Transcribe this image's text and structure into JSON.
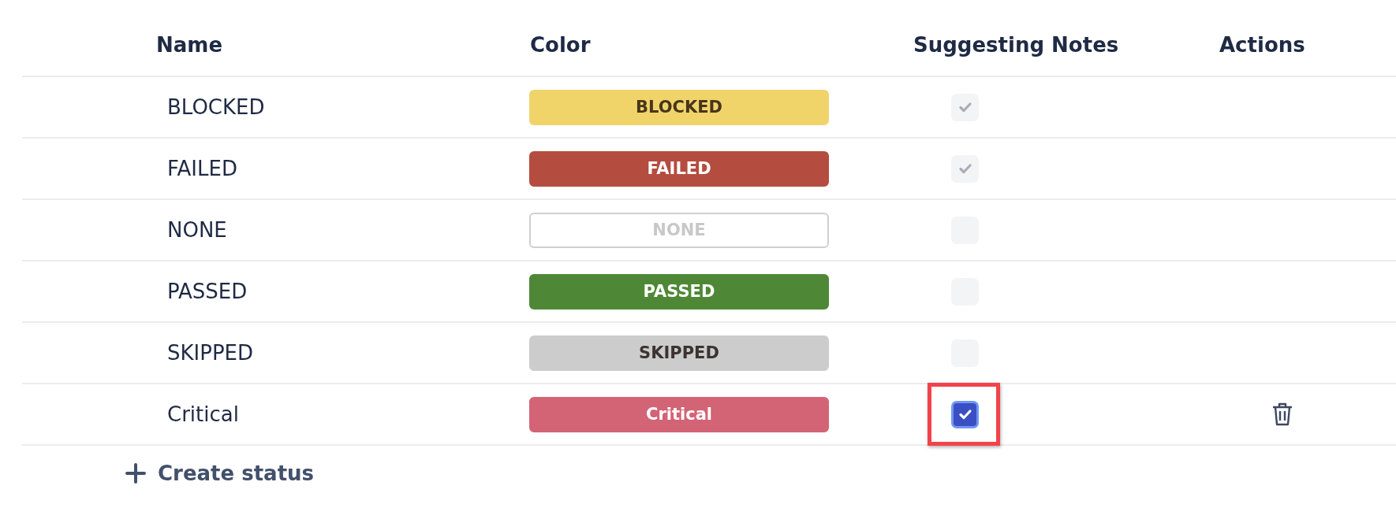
{
  "table": {
    "columns": [
      "Name",
      "Color",
      "Suggesting Notes",
      "Actions"
    ],
    "rows": [
      {
        "name": "BLOCKED",
        "chip": {
          "label": "BLOCKED",
          "color": "#f0d46a"
        },
        "suggesting_notes": {
          "checked": true,
          "disabled": true,
          "highlighted": false
        },
        "deletable": false
      },
      {
        "name": "FAILED",
        "chip": {
          "label": "FAILED",
          "color": "#b44d3f"
        },
        "suggesting_notes": {
          "checked": true,
          "disabled": true,
          "highlighted": false
        },
        "deletable": false
      },
      {
        "name": "NONE",
        "chip": {
          "label": "NONE",
          "color": "#ffffff"
        },
        "suggesting_notes": {
          "checked": false,
          "disabled": true,
          "highlighted": false
        },
        "deletable": false
      },
      {
        "name": "PASSED",
        "chip": {
          "label": "PASSED",
          "color": "#4e8836"
        },
        "suggesting_notes": {
          "checked": false,
          "disabled": true,
          "highlighted": false
        },
        "deletable": false
      },
      {
        "name": "SKIPPED",
        "chip": {
          "label": "SKIPPED",
          "color": "#cccccc"
        },
        "suggesting_notes": {
          "checked": false,
          "disabled": true,
          "highlighted": false
        },
        "deletable": false
      },
      {
        "name": "Critical",
        "chip": {
          "label": "Critical",
          "color": "#d26476"
        },
        "suggesting_notes": {
          "checked": true,
          "disabled": false,
          "highlighted": true
        },
        "deletable": true
      }
    ]
  },
  "create_button": {
    "label": "Create status"
  }
}
